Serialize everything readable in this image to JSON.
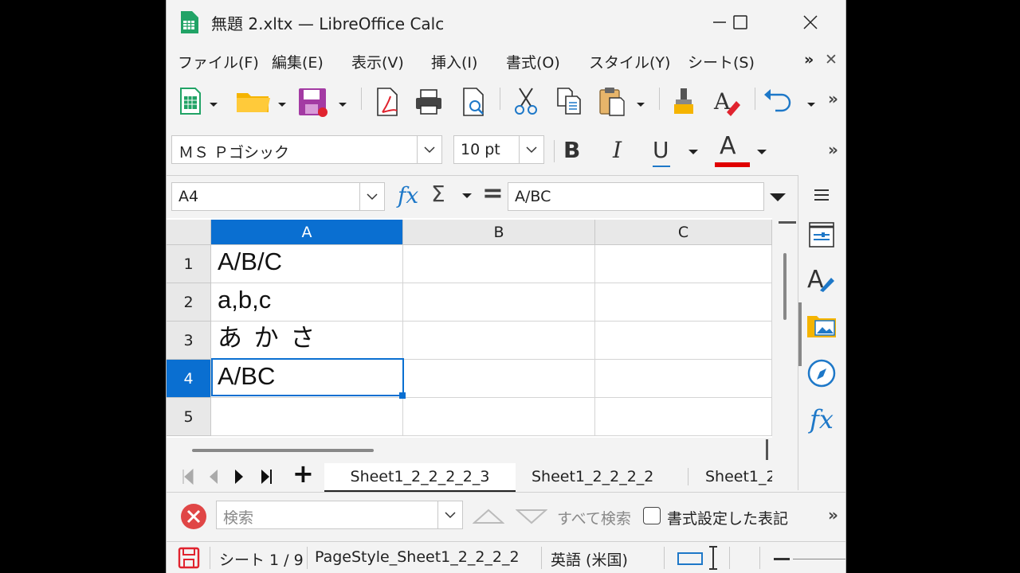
{
  "window": {
    "title": "無題 2.xltx — LibreOffice Calc"
  },
  "menu": {
    "items": [
      "ファイル(F)",
      "編集(E)",
      "表示(V)",
      "挿入(I)",
      "書式(O)",
      "スタイル(Y)",
      "シート(S)"
    ],
    "overflow": "»",
    "close": "✕"
  },
  "format": {
    "font_name": "ＭＳ Ｐゴシック",
    "font_size": "10 pt",
    "bold": "B",
    "italic": "I",
    "underline": "U",
    "font_color_letter": "A",
    "font_color": "#e00000",
    "overflow": "»"
  },
  "formula": {
    "cell_ref": "A4",
    "fx": "fx",
    "sum": "Σ",
    "equals": "=",
    "content": "A/BC"
  },
  "sheet": {
    "columns": [
      "A",
      "B",
      "C"
    ],
    "rows": [
      "1",
      "2",
      "3",
      "4",
      "5"
    ],
    "cells": {
      "A1": "A/B/C",
      "A2": "a,b,c",
      "A3": "あ か さ",
      "A4": "A/BC"
    },
    "selected_cell": "A4",
    "accent": "#0a6fd1"
  },
  "tabs": {
    "items": [
      "Sheet1_2_2_2_2_3",
      "Sheet1_2_2_2_2",
      "Sheet1_2"
    ],
    "add": "+"
  },
  "find": {
    "placeholder": "検索",
    "find_all": "すべて検索",
    "formatted_display": "書式設定した表記",
    "overflow": "»"
  },
  "status": {
    "sheet": "シート 1 / 9",
    "page_style": "PageStyle_Sheet1_2_2_2_2",
    "language": "英語 (米国)"
  }
}
